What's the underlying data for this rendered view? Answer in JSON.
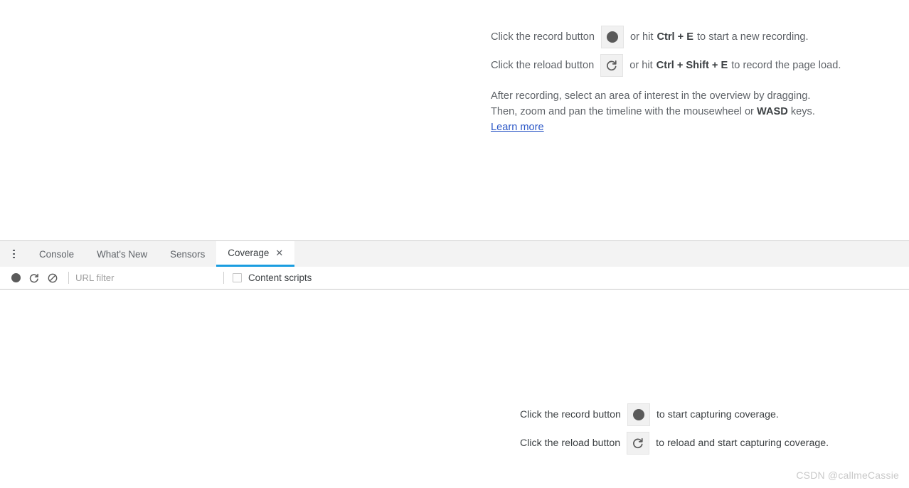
{
  "performance_panel": {
    "record_hint": {
      "prefix": "Click the record button",
      "button_icon": "record-dot-icon",
      "middle": "or hit",
      "shortcut": "Ctrl + E",
      "suffix": "to start a new recording."
    },
    "reload_hint": {
      "prefix": "Click the reload button",
      "button_icon": "reload-icon",
      "middle": "or hit",
      "shortcut": "Ctrl + Shift + E",
      "suffix": "to record the page load."
    },
    "paragraph": {
      "line1": "After recording, select an area of interest in the overview by dragging.",
      "line2_pre": "Then, zoom and pan the timeline with the mousewheel or",
      "line2_kbd": "WASD",
      "line2_post": "keys.",
      "learn_more": "Learn more"
    }
  },
  "drawer": {
    "menu_icon": "kebab-menu-icon",
    "tabs": [
      {
        "label": "Console",
        "active": false,
        "closable": false
      },
      {
        "label": "What's New",
        "active": false,
        "closable": false
      },
      {
        "label": "Sensors",
        "active": false,
        "closable": false
      },
      {
        "label": "Coverage",
        "active": true,
        "closable": true,
        "close_glyph": "✕"
      }
    ],
    "toolbar": {
      "record_icon": "record-dot-icon",
      "reload_icon": "reload-icon",
      "clear_icon": "clear-block-icon",
      "url_filter_placeholder": "URL filter",
      "url_filter_value": "",
      "content_scripts_label": "Content scripts",
      "content_scripts_checked": false
    }
  },
  "coverage_panel": {
    "record_hint": {
      "prefix": "Click the record button",
      "button_icon": "record-dot-icon",
      "suffix": "to start capturing coverage."
    },
    "reload_hint": {
      "prefix": "Click the reload button",
      "button_icon": "reload-icon",
      "suffix": "to reload and start capturing coverage."
    }
  },
  "watermark": {
    "text": "CSDN @callmeCassie"
  },
  "colors": {
    "accent_tab_underline": "#1a9de0",
    "link": "#2a56c6",
    "text_muted": "#5f6368",
    "text_primary": "#3c4043",
    "chip_bg": "#f1f1f1",
    "tabbar_bg": "#f3f3f3"
  }
}
